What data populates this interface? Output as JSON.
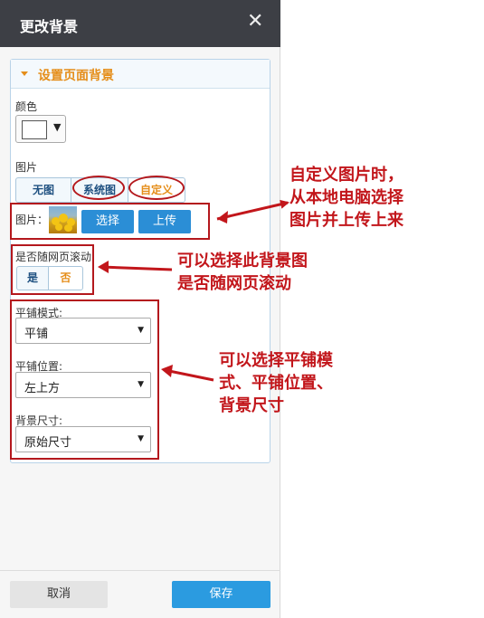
{
  "dialog": {
    "title": "更改背景",
    "close_glyph": "✕"
  },
  "section": {
    "title": "设置页面背景"
  },
  "color": {
    "label": "颜色",
    "value": "#ffffff",
    "dropdown_glyph": "▼"
  },
  "picture": {
    "label": "图片",
    "tabs": [
      {
        "label": "无图",
        "selected": false
      },
      {
        "label": "系统图",
        "selected": false
      },
      {
        "label": "自定义",
        "selected": true
      }
    ],
    "image_label": "图片：",
    "choose_button": "选择",
    "upload_button": "上传"
  },
  "scroll": {
    "label": "是否随网页滚动",
    "options": [
      {
        "label": "是",
        "selected": false
      },
      {
        "label": "否",
        "selected": true
      }
    ]
  },
  "tile_mode": {
    "label": "平铺模式:",
    "value": "平铺"
  },
  "tile_position": {
    "label": "平铺位置:",
    "value": "左上方"
  },
  "bg_size": {
    "label": "背景尺寸:",
    "value": "原始尺寸"
  },
  "footer": {
    "cancel": "取消",
    "save": "保存"
  },
  "annotations": {
    "custom_image": "自定义图片时，\n从本地电脑选择\n图片并上传上来",
    "scroll": "可以选择此背景图\n是否随网页滚动",
    "tiling": "可以选择平铺模\n式、平铺位置、\n背景尺寸"
  },
  "colors": {
    "titlebar": "#3d3f45",
    "accent_orange": "#e58e1a",
    "button_blue": "#2b8ed6",
    "annotation_red": "#c2161b"
  }
}
